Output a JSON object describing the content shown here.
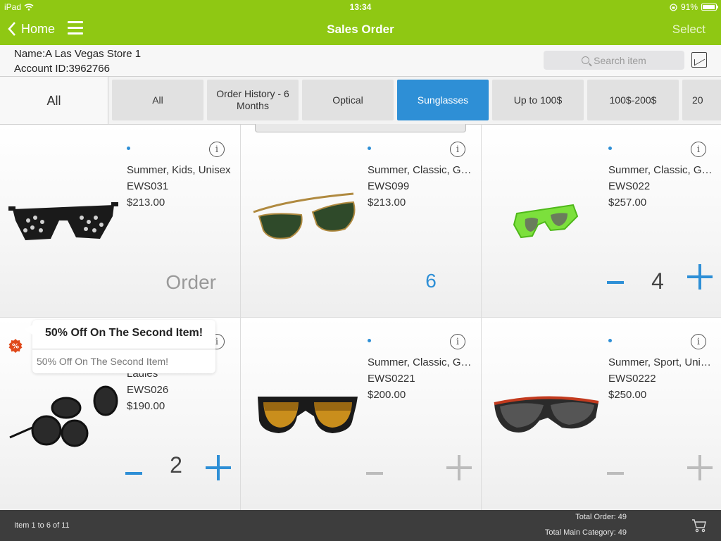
{
  "status": {
    "device": "iPad",
    "time": "13:34",
    "battery": "91%"
  },
  "nav": {
    "back_label": "Home",
    "title": "Sales Order",
    "select_label": "Select"
  },
  "customer": {
    "name": "Name:A Las Vegas Store 1",
    "account": "Account ID:3962766"
  },
  "search": {
    "placeholder": "Search item"
  },
  "categories": {
    "main": "All",
    "tabs": [
      {
        "label": "All"
      },
      {
        "label": "Order History - 6 Months"
      },
      {
        "label": "Optical"
      },
      {
        "label": "Sunglasses",
        "active": true
      },
      {
        "label": "Up to 100$"
      },
      {
        "label": "100$-200$"
      },
      {
        "label": "20"
      }
    ]
  },
  "products": [
    {
      "name": "Summer, Kids, Unisex",
      "code": "EWS031",
      "price": "$213.00",
      "order_label": "Order"
    },
    {
      "name": "Summer, Classic, Ge...",
      "code": "EWS099",
      "price": "$213.00",
      "qty": "6"
    },
    {
      "name": "Summer, Classic, Ge...",
      "code": "EWS022",
      "price": "$257.00",
      "qty": "4"
    },
    {
      "name": "Ladies",
      "code": "EWS026",
      "price": "$190.00",
      "qty": "2"
    },
    {
      "name": "Summer, Classic, Ge...",
      "code": "EWS0221",
      "price": "$200.00"
    },
    {
      "name": "Summer, Sport, Unisex",
      "code": "EWS0222",
      "price": "$250.00"
    }
  ],
  "promo": {
    "title": "50% Off On The Second Item!",
    "subtitle": "50% Off On The Second Item!"
  },
  "footer": {
    "range": "Item 1 to 6 of 11",
    "total_order": "Total Order: 49",
    "total_main_category": "Total Main Category: 49"
  },
  "colors": {
    "accent_green": "#8fc813",
    "accent_blue": "#2e8fd6",
    "footer_bg": "#3d3d3d"
  }
}
